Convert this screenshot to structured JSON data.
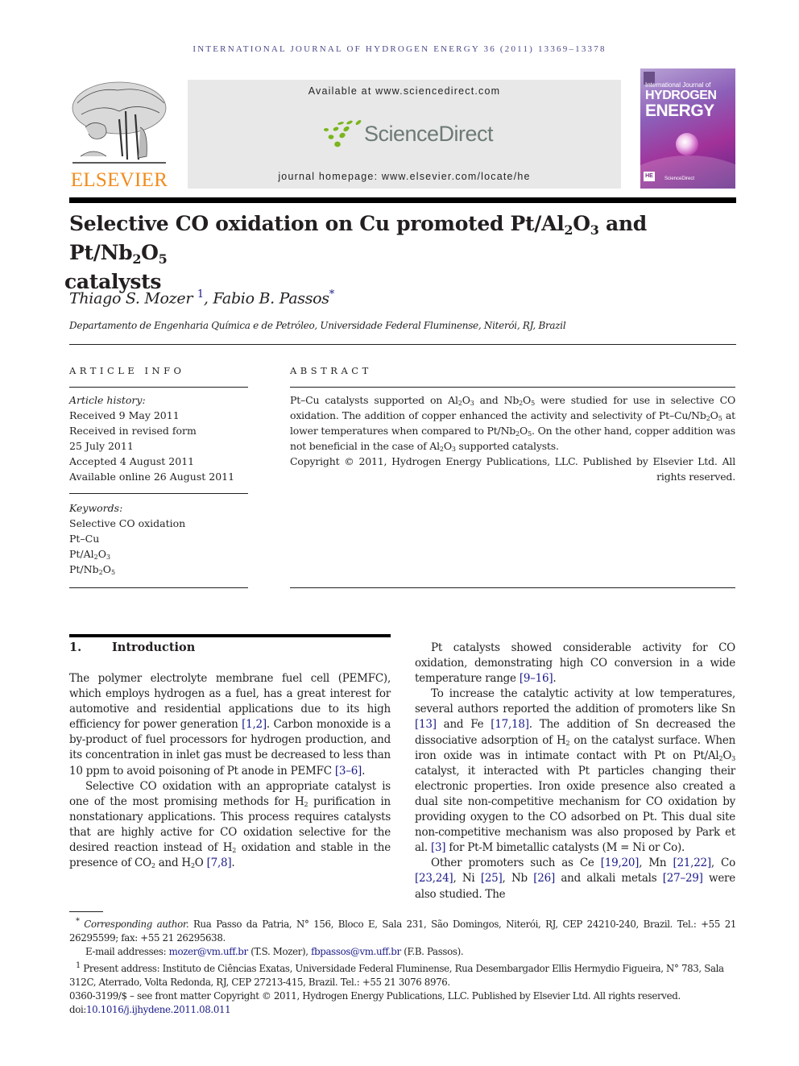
{
  "header": {
    "journal_line": "INTERNATIONAL JOURNAL OF HYDROGEN ENERGY 36 (2011) 13369–13378",
    "publisher_logo_text": "ELSEVIER",
    "available_at": "Available at www.sciencedirect.com",
    "sciencedirect_logo_text": "ScienceDirect",
    "journal_homepage": "journal homepage: www.elsevier.com/locate/he",
    "cover": {
      "line1": "International Journal of",
      "line2": "HYDROGEN",
      "line3": "ENERGY",
      "badge": "HE",
      "footer": "ScienceDirect"
    },
    "colors": {
      "elsevier_orange": "#f28c1c",
      "sd_green": "#7ab51d",
      "link_blue": "#1a1a8a"
    }
  },
  "article": {
    "title_parts": {
      "a": "Selective CO oxidation on Cu promoted Pt/Al",
      "b": "2",
      "c": "O",
      "d": "3",
      "e": " and Pt/Nb",
      "f": "2",
      "g": "O",
      "h": "5",
      "i": " catalysts"
    },
    "authors": [
      {
        "name": "Thiago S. Mozer",
        "mark": "1"
      },
      {
        "name": "Fabio B. Passos",
        "mark": "*"
      }
    ],
    "affiliation": "Departamento de Engenharia Química e de Petróleo, Universidade Federal Fluminense, Niterói, RJ, Brazil"
  },
  "article_info": {
    "heading": "ARTICLE INFO",
    "history_label": "Article history:",
    "history": [
      "Received 9 May 2011",
      "Received in revised form",
      "25 July 2011",
      "Accepted 4 August 2011",
      "Available online 26 August 2011"
    ],
    "keywords_label": "Keywords:",
    "keywords": [
      "Selective CO oxidation",
      "Pt–Cu",
      "Pt/Al2O3",
      "Pt/Nb2O5"
    ]
  },
  "abstract": {
    "heading": "ABSTRACT",
    "text_parts": {
      "p1": "Pt–Cu catalysts supported on Al",
      "p2": " and Nb",
      "p3": " were studied for use in selective CO oxidation. The addition of copper enhanced the activity and selectivity of Pt–Cu/Nb",
      "p4": " at lower temperatures when compared to Pt/Nb",
      "p5": ". On the other hand, copper addition was not beneficial in the case of Al",
      "p6": " supported catalysts."
    },
    "copyright": "Copyright © 2011, Hydrogen Energy Publications, LLC. Published by Elsevier Ltd. All rights reserved."
  },
  "section1": {
    "number": "1.",
    "title": "Introduction",
    "left_col": {
      "p1a": "The polymer electrolyte membrane fuel cell (PEMFC), which employs hydrogen as a fuel, has a great interest for automotive and residential applications due to its high efficiency for power generation ",
      "r1": "[1,2]",
      "p1b": ". Carbon monoxide is a by-product of fuel processors for hydrogen production, and its concentration in inlet gas must be decreased to less than 10 ppm to avoid poisoning of Pt anode in PEMFC ",
      "r2": "[3–6]",
      "p1c": ".",
      "p2a": "Selective CO oxidation with an appropriate catalyst is one of the most promising methods for H",
      "p2b": " purification in nonstationary applications. This process requires catalysts that are highly active for CO oxidation selective for the desired reaction instead of H",
      "p2c": " oxidation and stable in the presence of CO",
      "p2d": " and H",
      "p2e": "O ",
      "r3": "[7,8]",
      "p2f": "."
    },
    "right_col": {
      "p1a": "Pt catalysts showed considerable activity for CO oxidation, demonstrating high CO conversion in a wide temperature range ",
      "r1": "[9–16]",
      "p1b": ".",
      "p2a": "To increase the catalytic activity at low temperatures, several authors reported the addition of promoters like Sn ",
      "r2": "[13]",
      "p2b": " and Fe ",
      "r3": "[17,18]",
      "p2c": ". The addition of Sn decreased the dissociative adsorption of H",
      "p2d": " on the catalyst surface. When iron oxide was in intimate contact with Pt on Pt/Al",
      "p2e": " catalyst, it interacted with Pt particles changing their electronic properties. Iron oxide presence also created a dual site non-competitive mechanism for CO oxidation by providing oxygen to the CO adsorbed on Pt. This dual site non-competitive mechanism was also proposed by Park et al. ",
      "r4": "[3]",
      "p2f": " for Pt-M bimetallic catalysts (M = Ni or Co).",
      "p3a": "Other promoters such as Ce ",
      "r5": "[19,20]",
      "p3b": ", Mn ",
      "r6": "[21,22]",
      "p3c": ", Co ",
      "r7": "[23,24]",
      "p3d": ", Ni ",
      "r8": "[25]",
      "p3e": ", Nb ",
      "r9": "[26]",
      "p3f": " and alkali metals ",
      "r10": "[27–29]",
      "p3g": " were also studied. The"
    }
  },
  "footnotes": {
    "corr_mark": "*",
    "corr_label": "Corresponding author.",
    "corr_text": " Rua Passo da Patria, N° 156, Bloco E, Sala 231, São Domingos, Niterói, RJ, CEP 24210-240, Brazil. Tel.: +55 21 26295599; fax: +55 21 26295638.",
    "email_label": "E-mail addresses: ",
    "email1": "mozer@vm.uff.br",
    "email1_owner": " (T.S. Mozer), ",
    "email2": "fbpassos@vm.uff.br",
    "email2_owner": " (F.B. Passos).",
    "present_mark": "1",
    "present_text": " Present address: Instituto de Ciências Exatas, Universidade Federal Fluminense, Rua Desembargador Ellis Hermydio Figueira, N° 783, Sala 312C, Aterrado, Volta Redonda, RJ, CEP 27213-415, Brazil. Tel.: +55 21 3076 8976.",
    "issn_line": "0360-3199/$ – see front matter Copyright © 2011, Hydrogen Energy Publications, LLC. Published by Elsevier Ltd. All rights reserved.",
    "doi_label": "doi:",
    "doi": "10.1016/j.ijhydene.2011.08.011"
  }
}
